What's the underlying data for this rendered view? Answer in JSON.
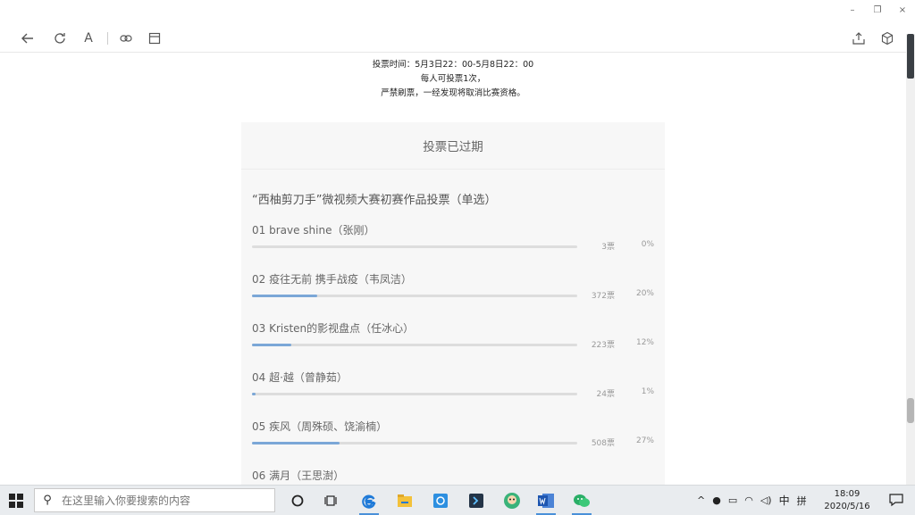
{
  "window": {
    "minimize": "–",
    "restore": "❐",
    "close": "×"
  },
  "toolbar": {
    "font_button": "A"
  },
  "notes": {
    "line1": "投票时间：5月3日22：00-5月8日22：00",
    "line2": "每人可投票1次，",
    "line3": "严禁刷票，一经发现将取消比赛资格。"
  },
  "poll": {
    "status": "投票已过期",
    "title": "“西柚剪刀手”微视频大赛初赛作品投票（单选）",
    "options": [
      {
        "label": "01 brave shine（张刚）",
        "votes": "3票",
        "percent": "0%",
        "fraction": 0.0
      },
      {
        "label": "02 疫往无前 携手战疫（韦凤洁）",
        "votes": "372票",
        "percent": "20%",
        "fraction": 0.2
      },
      {
        "label": "03 Kristen的影视盘点（任冰心）",
        "votes": "223票",
        "percent": "12%",
        "fraction": 0.12
      },
      {
        "label": "04 超·越（曾静茹）",
        "votes": "24票",
        "percent": "1%",
        "fraction": 0.01
      },
      {
        "label": "05 疾风（周殊硕、饶渝楠）",
        "votes": "508票",
        "percent": "27%",
        "fraction": 0.27
      },
      {
        "label": "06 满月（王思澍）",
        "votes": "",
        "percent": "",
        "fraction": null
      }
    ]
  },
  "taskbar": {
    "search_placeholder": "在这里输入你要搜索的内容",
    "ime_lang": "中",
    "ime_mode": "拼",
    "time": "18:09",
    "date": "2020/5/16"
  },
  "colors": {
    "bar_fill": "#7ba7d7",
    "bar_track": "#dddddd",
    "card_bg": "#f7f7f7"
  }
}
